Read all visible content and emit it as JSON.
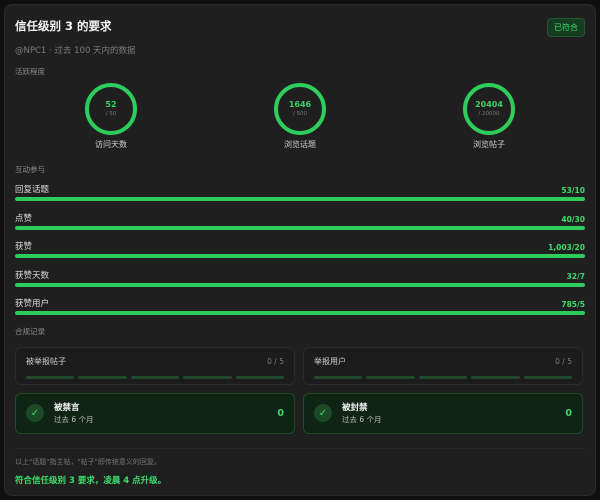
{
  "header": {
    "title": "信任级别 3 的要求",
    "badge": "已符合",
    "subtitle": "@NPC1 · 过去 100 天内的数据"
  },
  "activity": {
    "label": "活跃程度",
    "items": [
      {
        "value": "52",
        "max": "/ 50",
        "caption": "访问天数"
      },
      {
        "value": "1646",
        "max": "/ 500",
        "caption": "浏览话题"
      },
      {
        "value": "20404",
        "max": "/ 20000",
        "caption": "浏览帖子"
      }
    ]
  },
  "engagement": {
    "label": "互动参与",
    "items": [
      {
        "name": "回复话题",
        "value": "53/10",
        "progress": 1.0
      },
      {
        "name": "点赞",
        "value": "40/30",
        "progress": 1.0
      },
      {
        "name": "获赞",
        "value": "1,003/20",
        "progress": 1.0
      },
      {
        "name": "获赞天数",
        "value": "32/7",
        "progress": 1.0
      },
      {
        "name": "获赞用户",
        "value": "785/5",
        "progress": 1.0
      }
    ]
  },
  "compliance": {
    "label": "合规记录",
    "counters": [
      {
        "name": "被举报帖子",
        "count": "0 / 5",
        "segments": 5
      },
      {
        "name": "举报用户",
        "count": "0 / 5",
        "segments": 5
      }
    ],
    "statuses": [
      {
        "name": "被禁言",
        "sub": "过去 6 个月",
        "value": "0"
      },
      {
        "name": "被封禁",
        "sub": "过去 6 个月",
        "value": "0"
      }
    ]
  },
  "footer": {
    "note": "以上\"话题\"指主帖，\"帖子\"即传统意义的回复。",
    "result": "符合信任级别 3 要求，凌晨 4 点升级。"
  },
  "colors": {
    "accent": "#2ecc5a",
    "background": "#1f1f1f"
  }
}
